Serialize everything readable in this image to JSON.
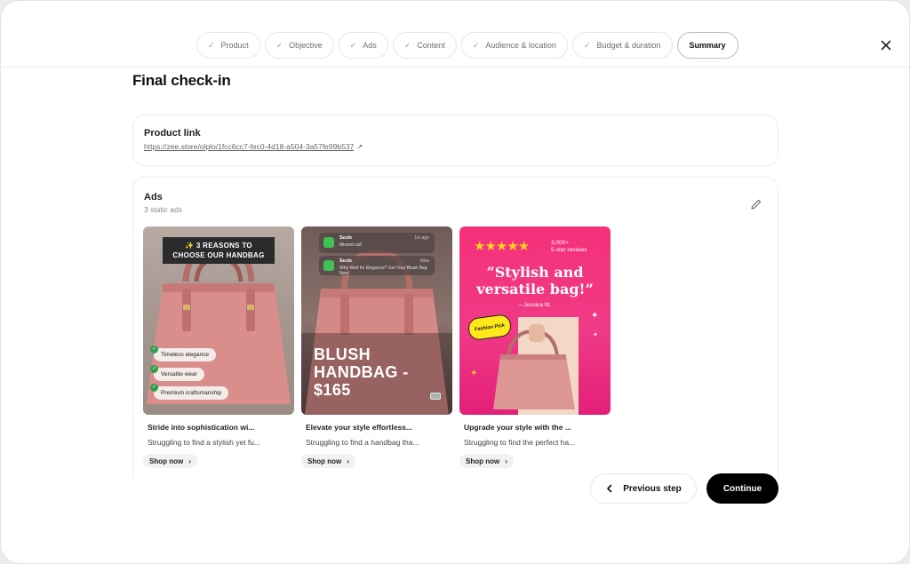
{
  "stepper": {
    "steps": [
      {
        "label": "Product",
        "done": true
      },
      {
        "label": "Objective",
        "done": true
      },
      {
        "label": "Ads",
        "done": true
      },
      {
        "label": "Content",
        "done": true
      },
      {
        "label": "Audience & location",
        "done": true
      },
      {
        "label": "Budget & duration",
        "done": true
      },
      {
        "label": "Summary",
        "done": false,
        "active": true
      }
    ]
  },
  "page": {
    "title": "Final check-in"
  },
  "product": {
    "heading": "Product link",
    "url": "https://zee.store/olplo/1fcc6cc7-fec0-4d18-a504-3a57fe99b537"
  },
  "ads": {
    "heading": "Ads",
    "subtitle": "3 static ads",
    "items": [
      {
        "banner": "✨ 3 REASONS TO\nCHOOSE OUR HANDBAG",
        "badges": [
          "Timeless elegance",
          "Versatile wear",
          "Premium craftsmanship"
        ],
        "title": "Stride into sophistication wi...",
        "description": "Struggling to find a stylish yet fu...",
        "cta": "Shop now"
      },
      {
        "notifications": [
          {
            "app": "Sezle",
            "text": "Missed call",
            "time": "1m ago"
          },
          {
            "app": "Sezle",
            "text": "Why Wait for Elegance? Get Your Blush Bag Now!",
            "time": "Now"
          }
        ],
        "overlay": "BLUSH HANDBAG - $165",
        "title": "Elevate your style effortless...",
        "description": "Struggling to find a handbag tha...",
        "cta": "Shop now"
      },
      {
        "stars": "★★★★★",
        "reviews_count": "3,000+",
        "reviews_label": "5-star reviews",
        "quote": "“Stylish and versatile bag!”",
        "author": "– Jessica M.",
        "sticker": "Fashion Pick",
        "title": "Upgrade your style with the ...",
        "description": "Struggling to find the perfect ha...",
        "cta": "Shop now"
      }
    ]
  },
  "footer": {
    "previous": "Previous step",
    "continue": "Continue"
  },
  "colors": {
    "primary_button": "#000000",
    "ad3_background": "#f5307a",
    "star": "#ffd21d",
    "check_badge": "#2e9e4a"
  },
  "icons": {
    "close": "close-icon",
    "edit": "pencil-icon",
    "external": "external-link-icon",
    "check": "check-icon"
  }
}
